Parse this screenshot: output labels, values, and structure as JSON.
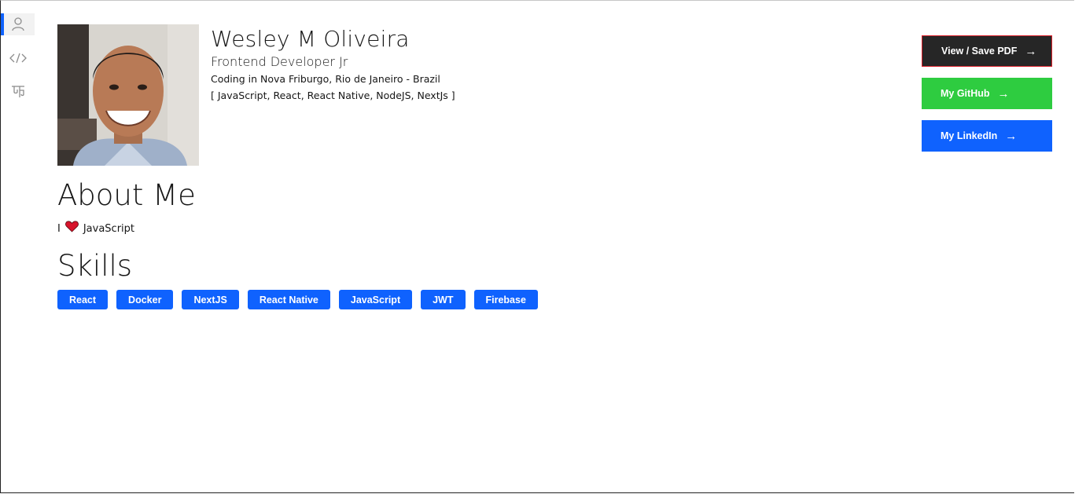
{
  "nav": {
    "items": [
      {
        "icon": "user-icon",
        "active": true
      },
      {
        "icon": "code-icon",
        "active": false
      },
      {
        "icon": "translate-icon",
        "active": false
      }
    ]
  },
  "profile": {
    "name": "Wesley M Oliveira",
    "role": "Frontend Developer Jr",
    "location": "Coding in Nova Friburgo, Rio de Janeiro - Brazil",
    "stack": "[ JavaScript, React, React Native, NodeJS, NextJs ]"
  },
  "actions": {
    "pdf_label": "View / Save PDF",
    "github_label": "My GitHub",
    "linkedin_label": "My LinkedIn",
    "arrow": "→"
  },
  "about": {
    "heading": "About Me",
    "prefix": "I",
    "suffix": "JavaScript"
  },
  "skills": {
    "heading": "Skills",
    "items": [
      "React",
      "Docker",
      "NextJS",
      "React Native",
      "JavaScript",
      "JWT",
      "Firebase"
    ]
  },
  "colors": {
    "accent": "#0f62fe",
    "github": "#2ecc40",
    "pdf_bg": "#262626",
    "pdf_border": "#da1e28"
  }
}
